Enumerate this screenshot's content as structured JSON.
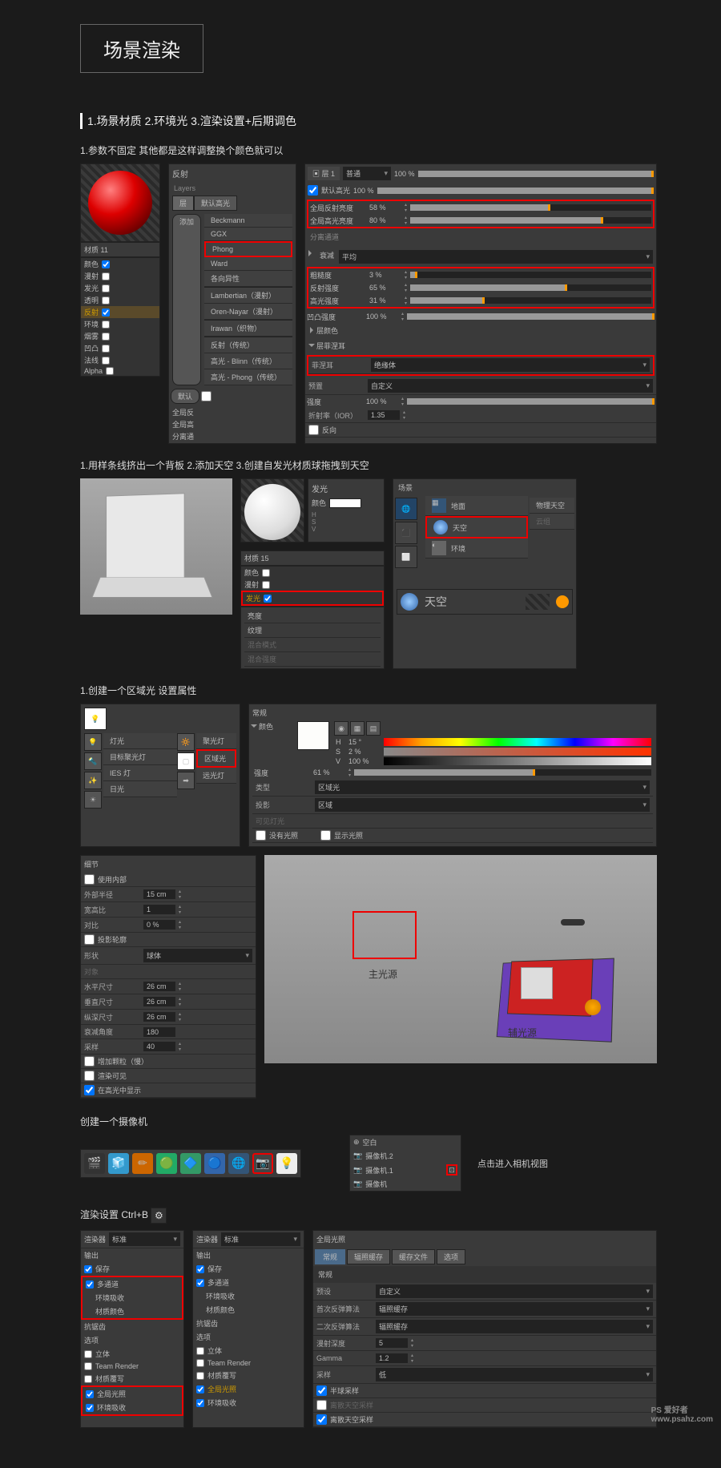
{
  "title": "场景渲染",
  "section_steps": "1.场景材质  2.环境光 3.渲染设置+后期调色",
  "step1": "1.参数不固定 其他都是这样调整换个颜色就可以",
  "mat": {
    "name": "材质 11",
    "reflect_hdr": "反射",
    "layers": "Layers",
    "tab_layer": "层",
    "tab_default": "默认高光",
    "add_btn": "添加",
    "default_chk": "默认",
    "channels": [
      "颜色",
      "漫射",
      "发光",
      "透明",
      "反射",
      "环境",
      "烟雾",
      "凹凸",
      "法线",
      "Alpha"
    ],
    "brdf_list": [
      "Beckmann",
      "GGX",
      "Phong",
      "Ward",
      "各向异性",
      "Lambertian（漫射）",
      "Oren-Nayar（漫射）",
      "Irawan（织物）",
      "反射（传统）",
      "高光 - Blinn（传统）",
      "高光 - Phong（传统）"
    ],
    "side_labels": [
      "全局反",
      "全局高",
      "分离通"
    ]
  },
  "refl_params": {
    "layer1": "层 1",
    "normal": "普通",
    "p100": "100 %",
    "default_spec": "默认高光",
    "roughness": {
      "label": "全局反射亮度",
      "val": "58 %"
    },
    "spec": {
      "label": "全局高光亮度",
      "val": "80 %"
    },
    "separate": "分离通道",
    "atten_hdr": "衰减",
    "atten_mode": "平均",
    "rough2": {
      "label": "粗糙度",
      "val": "3 %"
    },
    "refl_str": {
      "label": "反射强度",
      "val": "65 %"
    },
    "spec_str": {
      "label": "高光强度",
      "val": "31 %"
    },
    "bump_str": {
      "label": "凹凸强度",
      "val": "100 %"
    },
    "layer_color": "层颜色",
    "fresnel_hdr": "层菲涅耳",
    "fresnel": {
      "label": "菲涅耳",
      "val": "绝缘体"
    },
    "preset": {
      "label": "预置",
      "val": "自定义"
    },
    "strength": {
      "label": "强度",
      "val": "100 %"
    },
    "ior": {
      "label": "折射率（IOR）",
      "val": "1.35"
    },
    "invert": "反向"
  },
  "step2": "1.用样条线挤出一个背板 2.添加天空 3.创建自发光材质球拖拽到天空",
  "lumin": {
    "hdr": "发光",
    "mat_name": "材质 15",
    "color": "颜色",
    "channels2": [
      "颜色",
      "漫射",
      "发光"
    ],
    "h": "H",
    "s": "S",
    "v": "V",
    "bright": "亮度",
    "tex": "纹理",
    "blend": "混合模式",
    "mix": "混合强度"
  },
  "sky_menu": {
    "hdr": "场景",
    "items": [
      "地面",
      "天空",
      "环境"
    ],
    "right_items": [
      "物理天空",
      "云组"
    ],
    "sky_obj": "天空"
  },
  "step3": "1.创建一个区域光 设置属性",
  "lights": {
    "light": "灯光",
    "target": "目标聚光灯",
    "ies": "IES 灯",
    "sun": "日光",
    "spot": "聚光灯",
    "area": "区域光",
    "inf": "远光灯"
  },
  "light_props": {
    "general": "常规",
    "color": "颜色",
    "h": {
      "label": "H",
      "val": "15 °"
    },
    "s": {
      "label": "S",
      "val": "2 %"
    },
    "v": {
      "label": "V",
      "val": "100 %"
    },
    "intensity": {
      "label": "强度",
      "val": "61 %"
    },
    "type": {
      "label": "类型",
      "val": "区域光"
    },
    "shadow": {
      "label": "投影",
      "val": "区域"
    },
    "visible": "可见灯光",
    "nolight": "没有光照",
    "showillum": "显示光照"
  },
  "detail": {
    "hdr": "细节",
    "use_inner": "使用内部",
    "outer_r": {
      "label": "外部半径",
      "val": "15 cm"
    },
    "aspect": {
      "label": "宽高比",
      "val": "1"
    },
    "contrast": {
      "label": "对比",
      "val": "0 %"
    },
    "proj": "投影轮廓",
    "shape": {
      "label": "形状",
      "val": "球体"
    },
    "obj": "对象",
    "hsize": {
      "label": "水平尺寸",
      "val": "26 cm"
    },
    "vsize": {
      "label": "垂直尺寸",
      "val": "26 cm"
    },
    "zsize": {
      "label": "纵深尺寸",
      "val": "26 cm"
    },
    "falloff": {
      "label": "衰减角度",
      "val": "180"
    },
    "samples": {
      "label": "采样",
      "val": "40"
    },
    "add_grain": "增加颗粒（慢）",
    "render_vis": "渲染可见",
    "show_spec": "在高光中显示"
  },
  "viewport_labels": {
    "main": "主光源",
    "fill": "辅光源"
  },
  "camera": {
    "hdr": "创建一个摄像机",
    "click_hint": "点击进入相机视图",
    "tree": [
      "空白",
      "摄像机.2",
      "摄像机.1",
      "摄像机"
    ]
  },
  "render": {
    "hdr": "渲染设置  Ctrl+B",
    "renderer": "渲染器",
    "standard": "标准",
    "output": "输出",
    "save": "保存",
    "multi": "多通道",
    "ao": "环境吸收",
    "matcol": "材质颜色",
    "aa": "抗锯齿",
    "options": "选项",
    "stereo": "立体",
    "team": "Team Render",
    "mat_override": "材质覆写",
    "gi": "全局光照",
    "ao2": "环境吸收",
    "gi_hdr": "全局光照",
    "tabs": [
      "常规",
      "辐照缓存",
      "缓存文件",
      "选项"
    ],
    "general": "常规",
    "preset": {
      "label": "预设",
      "val": "自定义"
    },
    "primary": {
      "label": "首次反弹算法",
      "val": "辐照缓存"
    },
    "secondary": {
      "label": "二次反弹算法",
      "val": "辐照缓存"
    },
    "depth": {
      "label": "漫射深度",
      "val": "5"
    },
    "gamma": {
      "label": "Gamma",
      "val": "1.2"
    },
    "samples": {
      "label": "采样",
      "val": "低"
    },
    "hemi": "半球采样",
    "discrete_ao": "离散天空采样",
    "discrete_sky": "离散天空采样"
  },
  "watermark": {
    "logo": "PS 爱好者",
    "url": "www.psahz.com"
  }
}
